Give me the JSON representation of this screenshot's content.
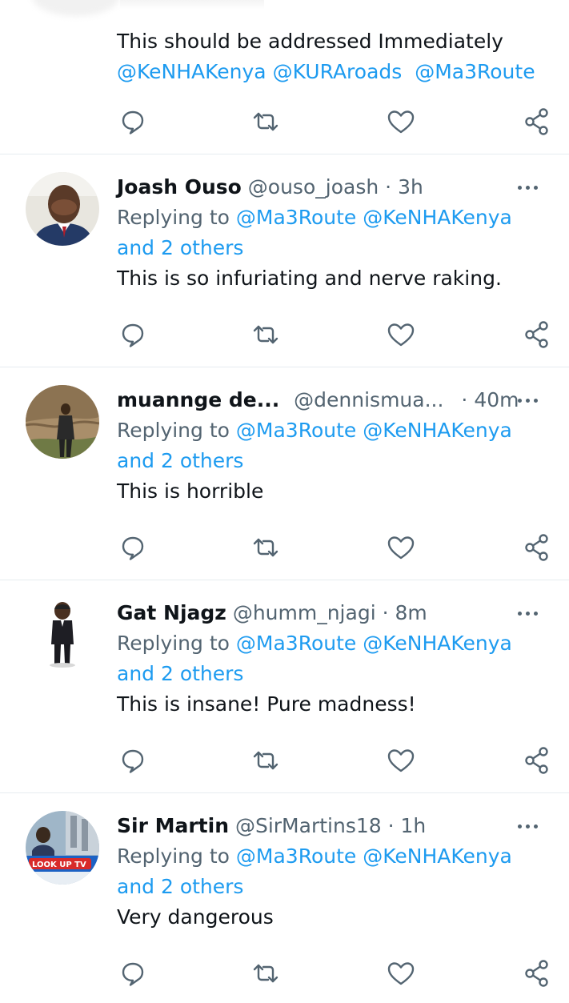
{
  "first_tweet": {
    "text": "This should be addressed Immediately",
    "mentions": [
      "@KeNHAKenya",
      "@KURAroads",
      "@Ma3Route"
    ]
  },
  "replies": [
    {
      "name": "Joash Ouso",
      "handle": "@ouso_joash",
      "time": "3h",
      "replying_prefix": "Replying to",
      "replying_handles": "@Ma3Route @KeNHAKenya",
      "others": "and 2 others",
      "text": "This is so infuriating and nerve raking."
    },
    {
      "name": "muannge de...",
      "handle": "@dennismua...",
      "time": "40m",
      "replying_prefix": "Replying to",
      "replying_handles": "@Ma3Route @KeNHAKenya",
      "others": "and 2 others",
      "text": "This is horrible"
    },
    {
      "name": "Gat Njagz",
      "handle": "@humm_njagi",
      "time": "8m",
      "replying_prefix": "Replying to",
      "replying_handles": "@Ma3Route @KeNHAKenya",
      "others": "and 2 others",
      "text": "This is insane! Pure madness!"
    },
    {
      "name": "Sir Martin",
      "handle": "@SirMartins18",
      "time": "1h",
      "replying_prefix": "Replying to",
      "replying_handles": "@Ma3Route @KeNHAKenya",
      "others": "and 2 others",
      "text": "Very dangerous",
      "avatar_text": "LOOK UP TV"
    }
  ],
  "separator": "·",
  "icons": [
    "reply-icon",
    "retweet-icon",
    "like-icon",
    "share-icon",
    "more-icon"
  ],
  "colors": {
    "link": "#1d9bf0",
    "secondary": "#536471",
    "text": "#0f1419",
    "divider": "#e6ecf0"
  }
}
